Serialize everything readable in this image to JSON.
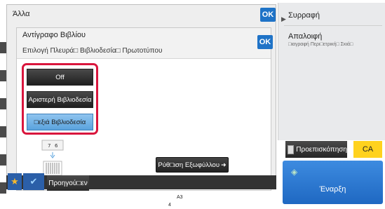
{
  "outer_dialog": {
    "title": "Άλλα",
    "ok_label": "OK"
  },
  "inner_dialog": {
    "title": "Αντίγραφο Βιβλίου",
    "subtitle": "Επιλογή Πλευρά□ Βιβλιοδεσία□ Πρωτοτύπου",
    "ok_label": "OK",
    "options": [
      {
        "label": "Off",
        "selected": false
      },
      {
        "label": "Αριστερή Βιβλιοδεσία",
        "selected": false
      },
      {
        "label": "□εξιά Βιβλιοδεσία",
        "selected": true
      }
    ],
    "cover_button_label": "Ρύθ□ιση Εξωφύλλου",
    "book_pages": [
      "7",
      "6"
    ]
  },
  "bottom_bar": {
    "prev_label": "Προηγού□εν",
    "paper_size": "A3",
    "tray_number": "4"
  },
  "right_panel": {
    "item1": "Συρραφή",
    "item2": "Απαλοιφή",
    "item2_sub": "□ιαγραφή Περι□ετρική□ Σκιά□"
  },
  "preview_label": "Προεπισκόπηση",
  "ca_label": "CA",
  "start_label": "Έναρξη",
  "colors": {
    "ok_blue": "#1f73c7",
    "highlight_red": "#d9163d",
    "selected_option": "#6fb1e6",
    "ca_yellow": "#ffd21e",
    "start_blue": "#2a76d0"
  }
}
